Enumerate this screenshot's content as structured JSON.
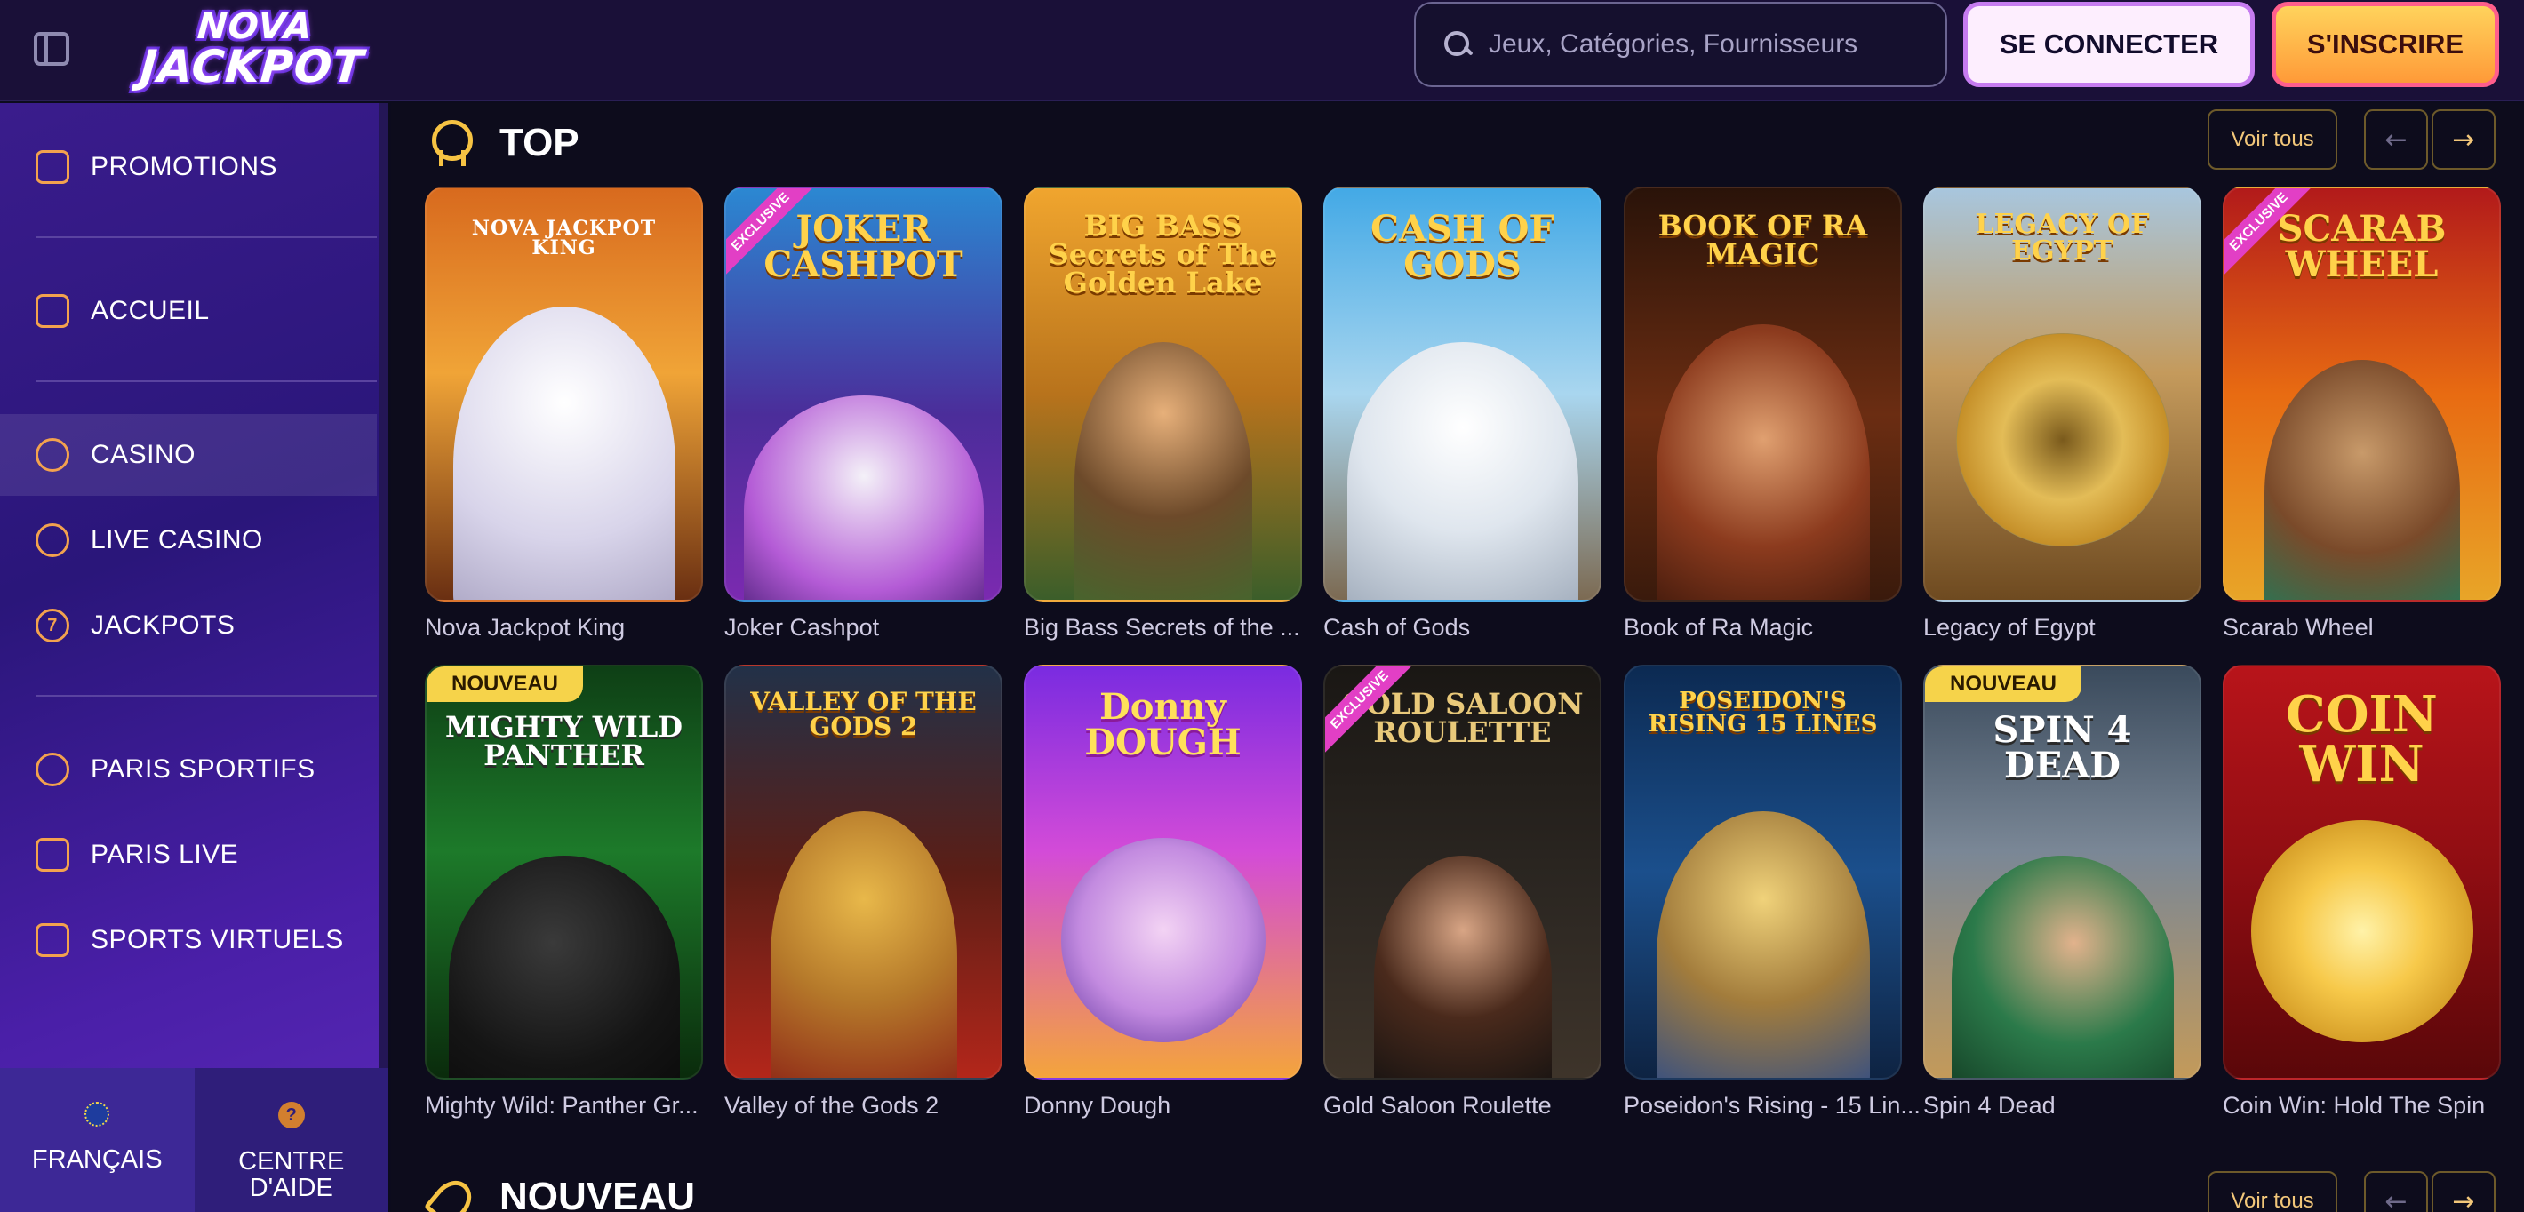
{
  "header": {
    "logo_line1": "NOVA",
    "logo_line2": "JACKPOT",
    "search_placeholder": "Jeux, Catégories, Fournisseurs",
    "login_label": "SE CONNECTER",
    "signup_label": "S'INSCRIRE"
  },
  "sidebar": {
    "items": [
      {
        "label": "PROMOTIONS",
        "icon": "gift-bag-icon"
      },
      {
        "label": "ACCUEIL",
        "icon": "home-icon"
      },
      {
        "label": "CASINO",
        "icon": "chip-icon",
        "active": true
      },
      {
        "label": "LIVE CASINO",
        "icon": "spade-icon"
      },
      {
        "label": "JACKPOTS",
        "icon": "seven-icon",
        "glyph": "7"
      },
      {
        "label": "PARIS SPORTIFS",
        "icon": "football-icon"
      },
      {
        "label": "PARIS LIVE",
        "icon": "play-icon"
      },
      {
        "label": "SPORTS VIRTUELS",
        "icon": "gamepad-icon"
      }
    ],
    "bottom": {
      "language_label": "FRANÇAIS",
      "help_label_line1": "CENTRE",
      "help_label_line2": "D'AIDE",
      "help_glyph": "?"
    }
  },
  "sections": {
    "top": {
      "title": "TOP",
      "see_all": "Voir tous",
      "prev": "←",
      "next": "→",
      "games": [
        {
          "name": "Nova Jackpot King",
          "art": "NOVA JACKPOT KING"
        },
        {
          "name": "Joker Cashpot",
          "art": "JOKER CASHPOT",
          "badge": "EXCLUSIVE"
        },
        {
          "name": "Big Bass Secrets of the ...",
          "art": "BIG BASS Secrets of The Golden Lake"
        },
        {
          "name": "Cash of Gods",
          "art": "CASH OF GODS"
        },
        {
          "name": "Book of Ra Magic",
          "art": "BOOK OF RA MAGIC"
        },
        {
          "name": "Legacy of Egypt",
          "art": "LEGACY OF EGYPT"
        },
        {
          "name": "Scarab Wheel",
          "art": "SCARAB WHEEL",
          "badge": "EXCLUSIVE"
        }
      ]
    },
    "row2": {
      "games": [
        {
          "name": "Mighty Wild: Panther Gr...",
          "art": "MIGHTY WILD PANTHER",
          "badge": "NOUVEAU"
        },
        {
          "name": "Valley of the Gods 2",
          "art": "VALLEY OF THE GODS 2"
        },
        {
          "name": "Donny Dough",
          "art": "Donny DOUGH"
        },
        {
          "name": "Gold Saloon Roulette",
          "art": "GOLD SALOON ROULETTE",
          "badge": "EXCLUSIVE"
        },
        {
          "name": "Poseidon's Rising - 15 Lin...",
          "art": "POSEIDON'S RISING 15 LINES"
        },
        {
          "name": "Spin 4 Dead",
          "art": "SPIN 4 DEAD",
          "badge": "NOUVEAU"
        },
        {
          "name": "Coin Win: Hold The Spin",
          "art": "COIN WIN"
        }
      ]
    },
    "new": {
      "title": "NOUVEAU",
      "see_all": "Voir tous",
      "prev": "←",
      "next": "→"
    }
  }
}
